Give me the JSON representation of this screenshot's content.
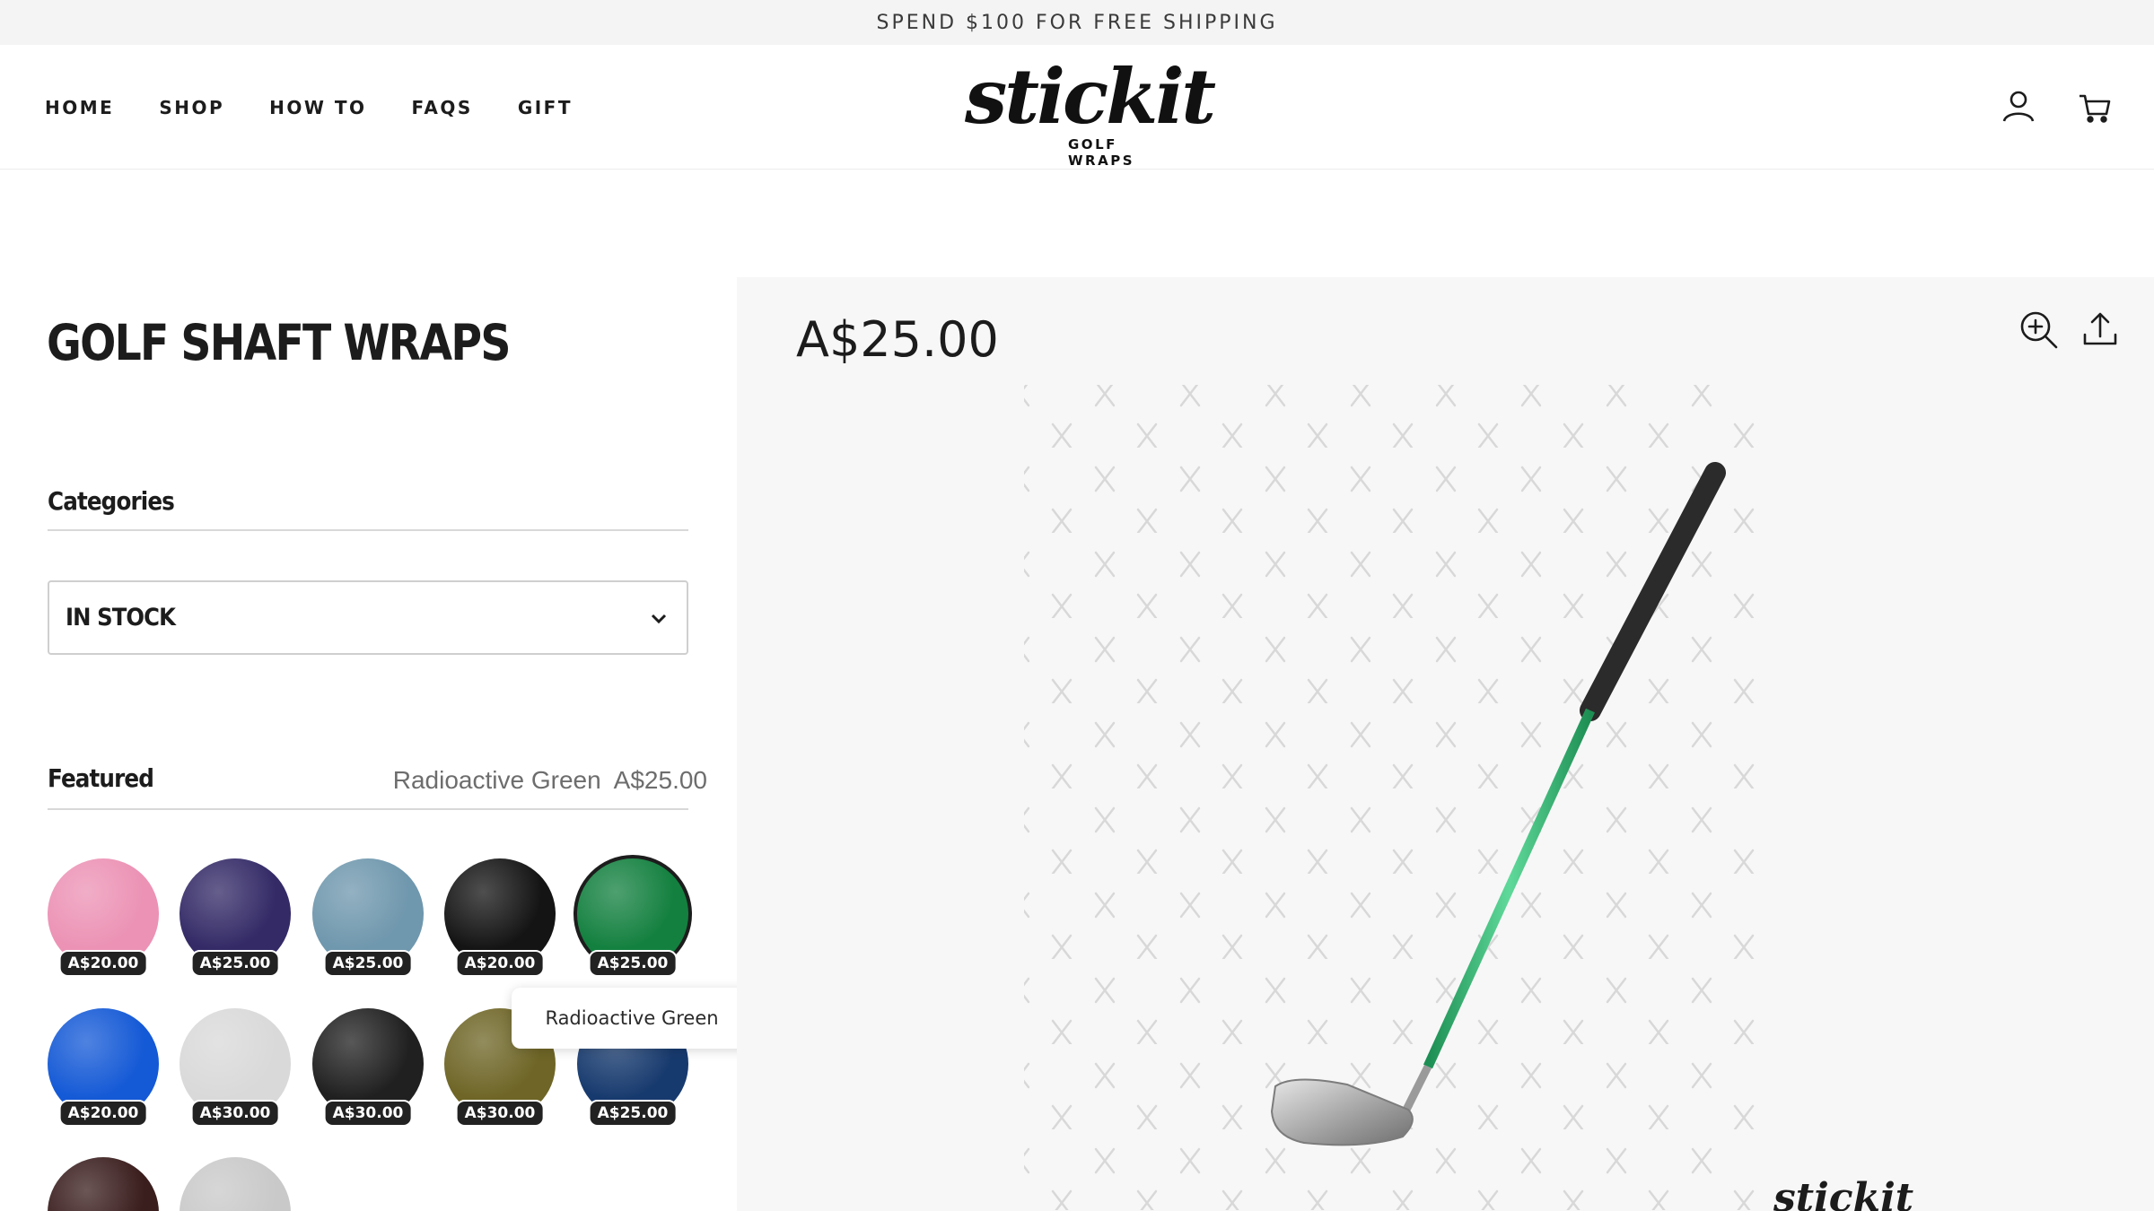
{
  "announcement": {
    "text": "SPEND $100 FOR FREE SHIPPING"
  },
  "nav": [
    {
      "label": "HOME"
    },
    {
      "label": "SHOP"
    },
    {
      "label": "HOW TO"
    },
    {
      "label": "FAQS"
    },
    {
      "label": "GIFT"
    }
  ],
  "logo": {
    "word": "stickit",
    "sub": "GOLF WRAPS",
    "reg": "®"
  },
  "header_icons": [
    "account-icon",
    "cart-icon"
  ],
  "page": {
    "title": "GOLF SHAFT WRAPS"
  },
  "categories": {
    "label": "Categories",
    "selected": "IN STOCK"
  },
  "featured": {
    "label": "Featured",
    "hover_name": "Radioactive Green",
    "hover_price": "A$25.00"
  },
  "swatches": [
    {
      "price": "A$20.00",
      "color": "#ec92b4"
    },
    {
      "price": "A$25.00",
      "color": "#332a66"
    },
    {
      "price": "A$25.00",
      "color": "#6f97ad"
    },
    {
      "price": "A$20.00",
      "color": "#141414"
    },
    {
      "price": "A$25.00",
      "color": "#13803f"
    },
    {
      "price": "A$20.00",
      "color": "#1459d6"
    },
    {
      "price": "A$30.00",
      "color": "#d9d9d9"
    },
    {
      "price": "A$30.00",
      "color": "#202020"
    },
    {
      "price": "A$30.00",
      "color": "#6e6526"
    },
    {
      "price": "A$25.00",
      "color": "#173a6e"
    },
    {
      "price": "",
      "color": "#3a1d1d"
    },
    {
      "price": "",
      "color": "#c9c9c9"
    }
  ],
  "tooltip": {
    "text": "Radioactive Green"
  },
  "gallery": {
    "price": "A$25.00",
    "watermark": "stickit"
  },
  "colors": {
    "accent_green": "#2fae68",
    "grip": "#2a2a2a"
  }
}
